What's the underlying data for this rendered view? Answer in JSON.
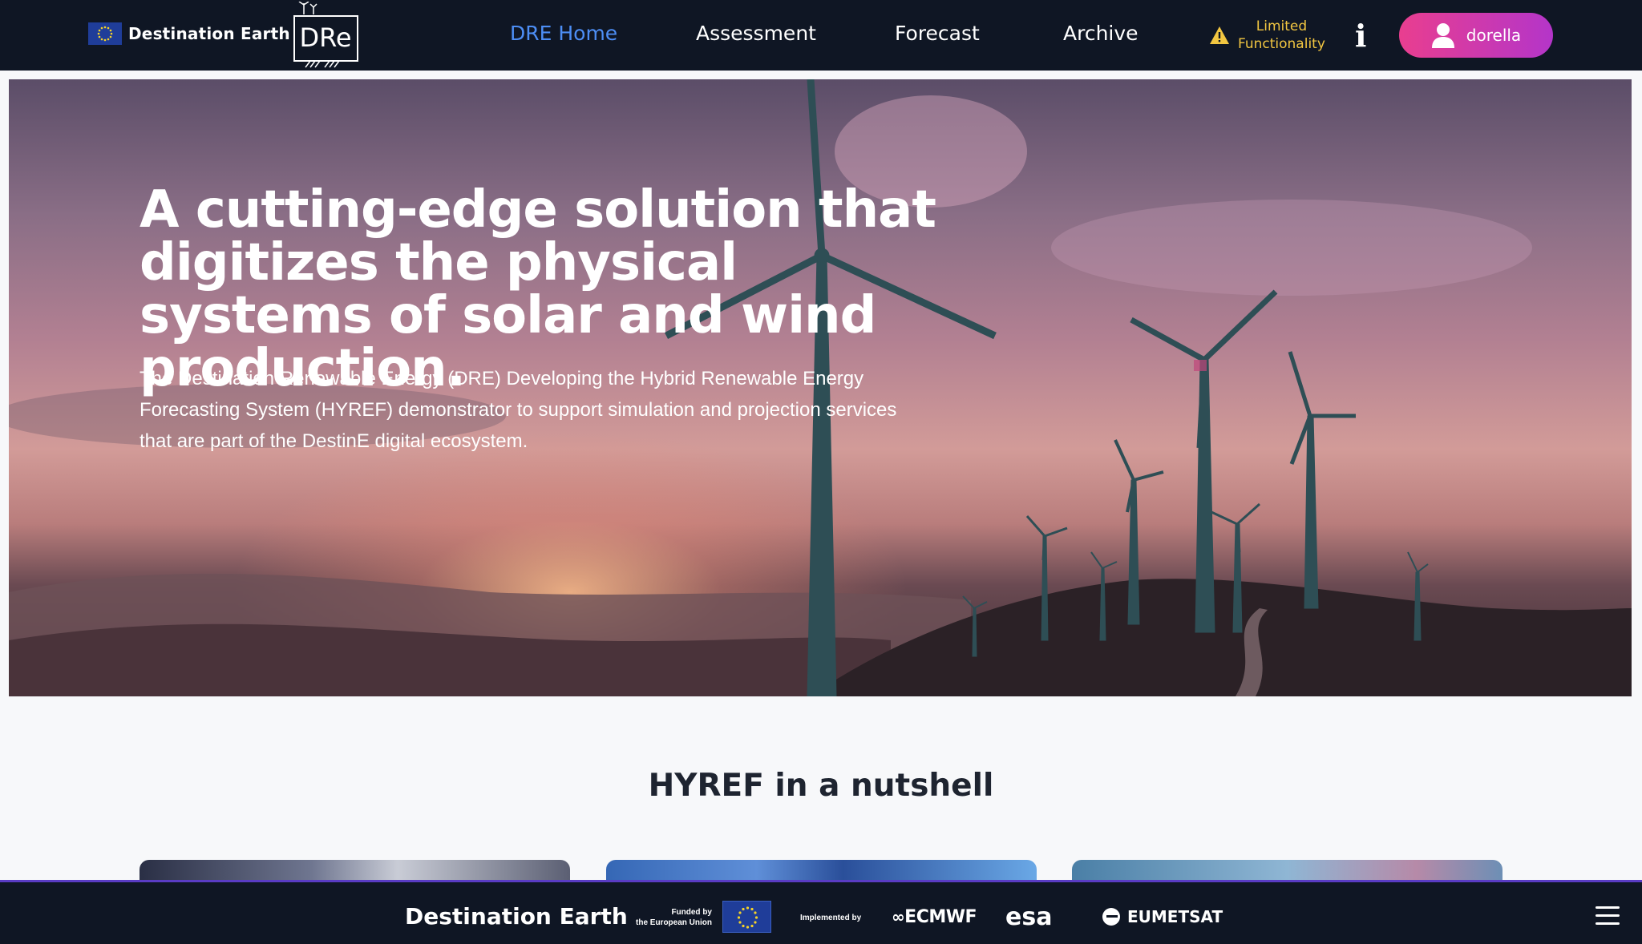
{
  "header": {
    "brand_text": "Destination Earth",
    "dre_logo_text": "DRe",
    "nav": [
      {
        "label": "DRE Home",
        "active": true
      },
      {
        "label": "Assessment"
      },
      {
        "label": "Forecast"
      },
      {
        "label": "Archive"
      }
    ],
    "status_line1": "Limited",
    "status_line2": "Functionality",
    "info_label": "i",
    "user_name": "dorella"
  },
  "hero": {
    "title": "A cutting-edge solution that digitizes the physical systems of solar and wind production.",
    "description": "The Destination Renewable Energy (DRE) Developing the Hybrid Renewable Energy Forecasting System (HYREF) demonstrator to support simulation and projection services that are part of the DestinE digital ecosystem."
  },
  "section": {
    "title": "HYREF in a nutshell"
  },
  "footer": {
    "brand_text": "Destination Earth",
    "funded_line1": "Funded by",
    "funded_line2": "the European Union",
    "implemented": "Implemented by",
    "partners": [
      "ECMWF",
      "esa",
      "EUMETSAT"
    ]
  },
  "colors": {
    "nav_bg": "#0f1624",
    "active_link": "#4d8ef5",
    "warning": "#f2c641",
    "user_gradient_start": "#e93e8f",
    "user_gradient_end": "#b435c9"
  }
}
